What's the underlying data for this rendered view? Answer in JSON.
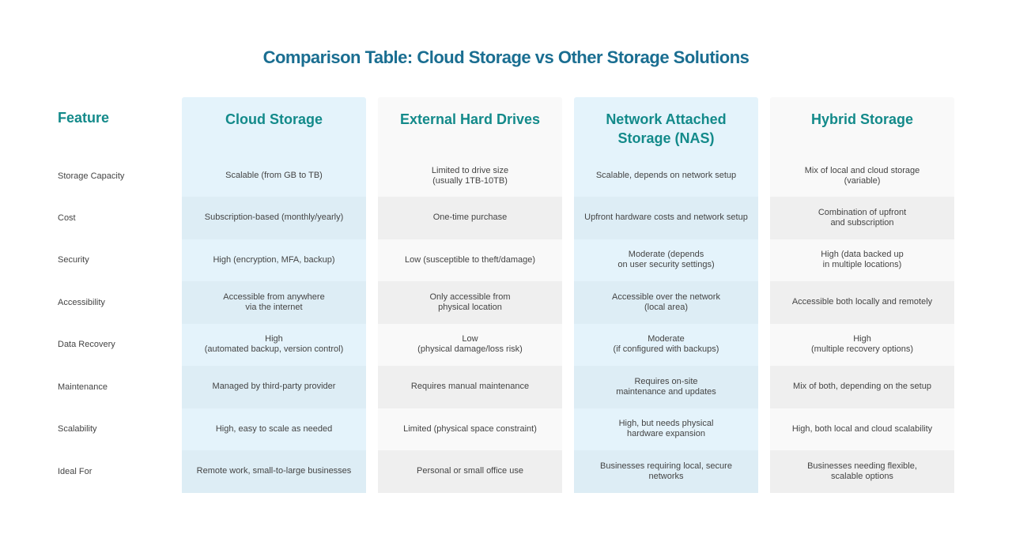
{
  "title": "Comparison Table: Cloud Storage vs Other Storage Solutions",
  "colors": {
    "title": "#1a6e91",
    "header": "#138a8a",
    "blue_light": "#e4f3fb",
    "blue_dark": "#ddedf5",
    "gray_light": "#f9f9f9",
    "gray_dark": "#efefef",
    "text": "#444444"
  },
  "table": {
    "feature_header": "Feature",
    "features": [
      "Storage Capacity",
      "Cost",
      "Security",
      "Accessibility",
      "Data Recovery",
      "Maintenance",
      "Scalability",
      "Ideal For"
    ],
    "columns": [
      {
        "header": "Cloud Storage",
        "theme": "blue",
        "cells": [
          "Scalable (from GB to TB)",
          "Subscription-based (monthly/yearly)",
          "High (encryption, MFA, backup)",
          "Accessible from anywhere\nvia the internet",
          "High\n(automated backup, version control)",
          "Managed by third-party provider",
          "High, easy to scale as needed",
          "Remote work, small-to-large businesses"
        ]
      },
      {
        "header": "External Hard Drives",
        "theme": "gray",
        "cells": [
          "Limited to drive size\n(usually 1TB-10TB)",
          "One-time purchase",
          "Low (susceptible to theft/damage)",
          "Only accessible from\nphysical location",
          "Low\n(physical damage/loss risk)",
          "Requires manual maintenance",
          "Limited (physical space constraint)",
          "Personal or small office use"
        ]
      },
      {
        "header": "Network Attached\nStorage (NAS)",
        "theme": "blue",
        "cells": [
          "Scalable, depends on network setup",
          "Upfront hardware costs and network setup",
          "Moderate (depends\non user security settings)",
          "Accessible over the network\n(local area)",
          "Moderate\n(if configured with backups)",
          "Requires on-site\nmaintenance and updates",
          "High, but needs physical\nhardware expansion",
          "Businesses requiring local, secure networks"
        ]
      },
      {
        "header": "Hybrid Storage",
        "theme": "gray",
        "cells": [
          "Mix of local and cloud storage\n(variable)",
          "Combination of upfront\nand subscription",
          "High (data backed up\nin multiple locations)",
          "Accessible both locally and remotely",
          "High\n(multiple recovery options)",
          "Mix of both, depending on the setup",
          "High, both local and cloud scalability",
          "Businesses needing flexible,\nscalable options"
        ]
      }
    ]
  }
}
